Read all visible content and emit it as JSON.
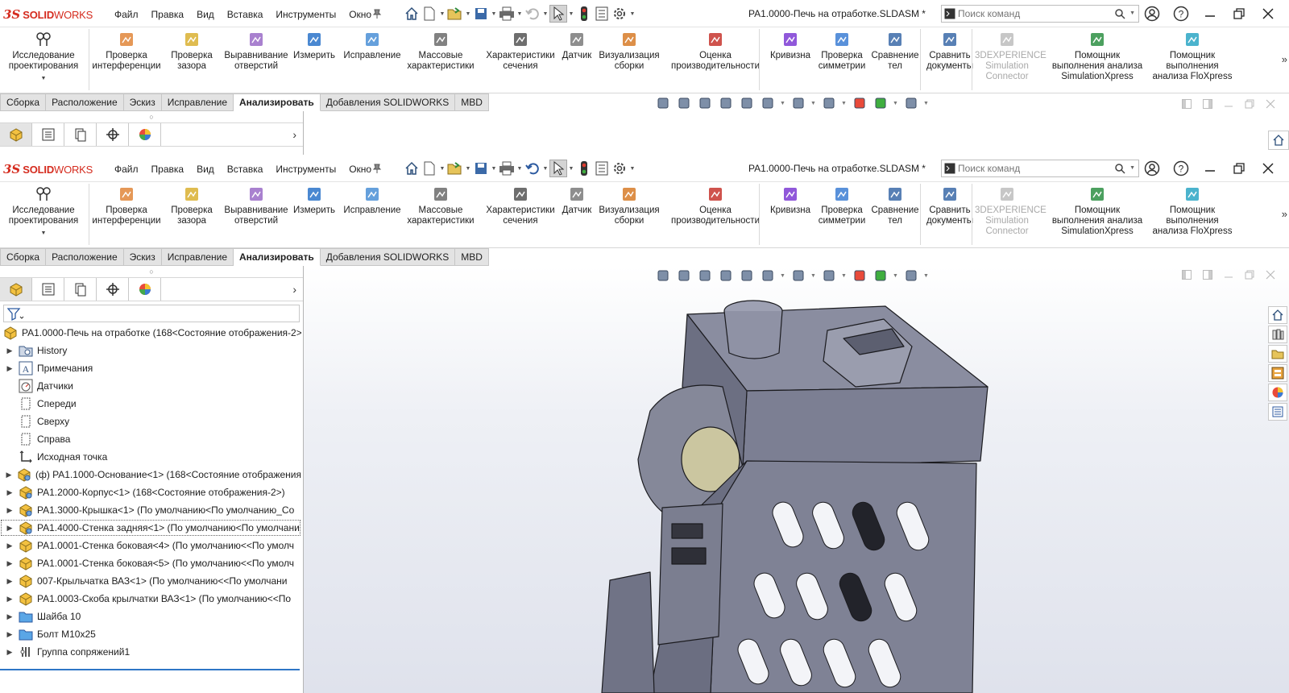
{
  "app": {
    "brand_ds": "3S",
    "brand_name": "SOLID",
    "brand_name2": "WORKS"
  },
  "menu": [
    "Файл",
    "Правка",
    "Вид",
    "Вставка",
    "Инструменты",
    "Окно"
  ],
  "document_title": "PA1.0000-Печь на отработке.SLDASM *",
  "search": {
    "placeholder": "Поиск команд"
  },
  "ribbon": {
    "design_study": "Исследование проектирования",
    "buttons": [
      {
        "label": "Проверка интерференции",
        "icon": "interference-icon"
      },
      {
        "label": "Проверка зазора",
        "icon": "clearance-icon"
      },
      {
        "label": "Выравнивание отверстий",
        "icon": "hole-alignment-icon"
      },
      {
        "label": "Измерить",
        "icon": "measure-icon"
      },
      {
        "label": "Исправление",
        "icon": "repair-icon"
      },
      {
        "label": "Массовые характеристики",
        "icon": "mass-properties-icon"
      },
      {
        "label": "Характеристики сечения",
        "icon": "section-properties-icon"
      },
      {
        "label": "Датчик",
        "icon": "sensor-icon"
      },
      {
        "label": "Визуализация сборки",
        "icon": "assembly-visualization-icon"
      },
      {
        "label": "Оценка производительности",
        "icon": "performance-icon"
      },
      {
        "label": "Кривизна",
        "icon": "curvature-icon"
      },
      {
        "label": "Проверка симметрии",
        "icon": "symmetry-icon"
      },
      {
        "label": "Сравнение тел",
        "icon": "compare-bodies-icon"
      },
      {
        "label": "Сравнить документы",
        "icon": "compare-documents-icon"
      },
      {
        "label": "3DEXPERIENCE Simulation Connector",
        "icon": "simulation-connector-icon"
      },
      {
        "label": "Помощник выполнения анализа SimulationXpress",
        "icon": "simulationxpress-icon"
      },
      {
        "label": "Помощник выполнения анализа FloXpress",
        "icon": "floxpress-icon"
      }
    ]
  },
  "tabs": [
    "Сборка",
    "Расположение",
    "Эскиз",
    "Исправление",
    "Анализировать",
    "Добавления SOLIDWORKS",
    "MBD"
  ],
  "active_tab": "Анализировать",
  "tree": {
    "root": "PA1.0000-Печь на отработке  (168<Состояние отображения-2>",
    "items": [
      {
        "label": "History",
        "icon": "history-folder-icon",
        "expandable": true
      },
      {
        "label": "Примечания",
        "icon": "annotations-icon",
        "expandable": true
      },
      {
        "label": "Датчики",
        "icon": "sensors-icon",
        "expandable": false
      },
      {
        "label": "Спереди",
        "icon": "plane-icon",
        "expandable": false
      },
      {
        "label": "Сверху",
        "icon": "plane-icon",
        "expandable": false
      },
      {
        "label": "Справа",
        "icon": "plane-icon",
        "expandable": false
      },
      {
        "label": "Исходная точка",
        "icon": "origin-icon",
        "expandable": false
      },
      {
        "label": "(ф) PA1.1000-Основание<1> (168<Состояние отображения",
        "icon": "subassembly-icon",
        "expandable": true
      },
      {
        "label": "PA1.2000-Корпус<1> (168<Состояние отображения-2>)",
        "icon": "subassembly-icon",
        "expandable": true
      },
      {
        "label": "PA1.3000-Крышка<1> (По умолчанию<По умолчанию_Со",
        "icon": "subassembly-icon",
        "expandable": true
      },
      {
        "label": "PA1.4000-Стенка задняя<1> (По умолчанию<По умолчани",
        "icon": "subassembly-icon",
        "expandable": true
      },
      {
        "label": "PA1.0001-Стенка боковая<4> (По умолчанию<<По умолч",
        "icon": "part-icon",
        "expandable": true
      },
      {
        "label": "PA1.0001-Стенка боковая<5> (По умолчанию<<По умолч",
        "icon": "part-icon",
        "expandable": true
      },
      {
        "label": "007-Крыльчатка ВАЗ<1> (По умолчанию<<По умолчани",
        "icon": "part-icon",
        "expandable": true
      },
      {
        "label": "PA1.0003-Скоба крылчатки ВАЗ<1> (По умолчанию<<По",
        "icon": "part-icon",
        "expandable": true
      },
      {
        "label": "Шайба 10",
        "icon": "folder-icon",
        "expandable": true
      },
      {
        "label": "Болт М10x25",
        "icon": "folder-icon",
        "expandable": true
      },
      {
        "label": "Группа сопряжений1",
        "icon": "mates-icon",
        "expandable": true
      }
    ]
  },
  "colors": {
    "brand": "#d52b1e",
    "tab_bg": "#e3e3e3",
    "selection_blue": "#2f76c6",
    "model_grey": "#8d90a3"
  }
}
